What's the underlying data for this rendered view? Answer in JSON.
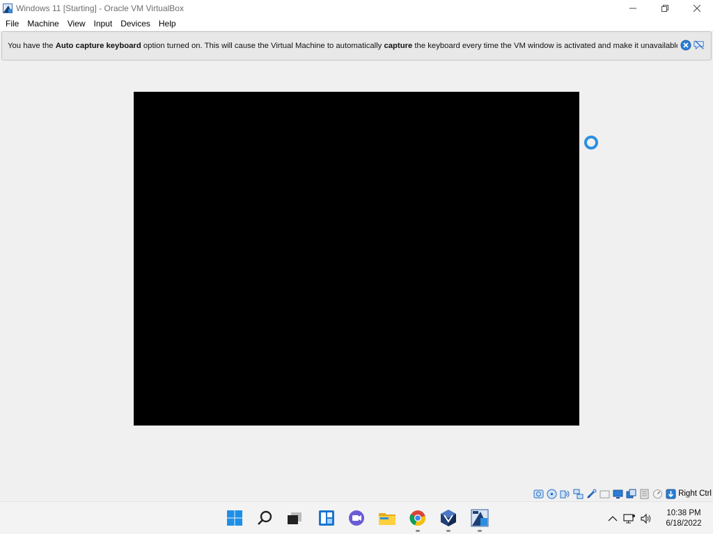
{
  "window": {
    "title": "Windows 11 [Starting] - Oracle VM VirtualBox",
    "app_icon": "virtualbox-vm-icon",
    "controls": {
      "minimize": "─",
      "maximize": "❐",
      "close": "✕"
    }
  },
  "menubar": {
    "items": [
      {
        "label": "File"
      },
      {
        "label": "Machine"
      },
      {
        "label": "View"
      },
      {
        "label": "Input"
      },
      {
        "label": "Devices"
      },
      {
        "label": "Help"
      }
    ]
  },
  "notification": {
    "parts": [
      {
        "text": "You have the ",
        "bold": false
      },
      {
        "text": "Auto capture keyboard",
        "bold": true
      },
      {
        "text": " option turned on. This will cause the Virtual Machine to automatically ",
        "bold": false
      },
      {
        "text": "capture",
        "bold": true
      },
      {
        "text": " the keyboard every time the VM window is activated and make it unavailable to",
        "bold": false
      }
    ],
    "buttons": [
      {
        "name": "close-notification-icon"
      },
      {
        "name": "do-not-show-again-icon"
      }
    ]
  },
  "vm": {
    "state": "Starting",
    "screen_color": "#000000"
  },
  "statusbar": {
    "icons": [
      "hard-disk-icon",
      "optical-drive-icon",
      "audio-icon",
      "network-icon",
      "usb-icon",
      "shared-folders-icon",
      "display-icon",
      "video-capture-icon",
      "virtualization-icon",
      "cpu-icon",
      "mouse-integration-icon",
      "host-key-icon"
    ],
    "host_key": "Right Ctrl"
  },
  "taskbar": {
    "apps": [
      {
        "name": "start-icon",
        "running": false
      },
      {
        "name": "search-icon",
        "running": false
      },
      {
        "name": "task-view-icon",
        "running": false
      },
      {
        "name": "widgets-icon",
        "running": false
      },
      {
        "name": "teams-chat-icon",
        "running": false
      },
      {
        "name": "file-explorer-icon",
        "running": false
      },
      {
        "name": "chrome-icon",
        "running": true
      },
      {
        "name": "virtualbox-icon",
        "running": true
      },
      {
        "name": "virtualbox-vm-icon",
        "running": true
      }
    ],
    "tray": {
      "icons": [
        "chevron-up-icon",
        "network-icon",
        "volume-icon"
      ],
      "time": "10:38 PM",
      "date": "6/18/2022"
    }
  },
  "colors": {
    "accent": "#2b8fe0",
    "background": "#f0f0f0",
    "notification_bg": "#e8e8e8"
  }
}
